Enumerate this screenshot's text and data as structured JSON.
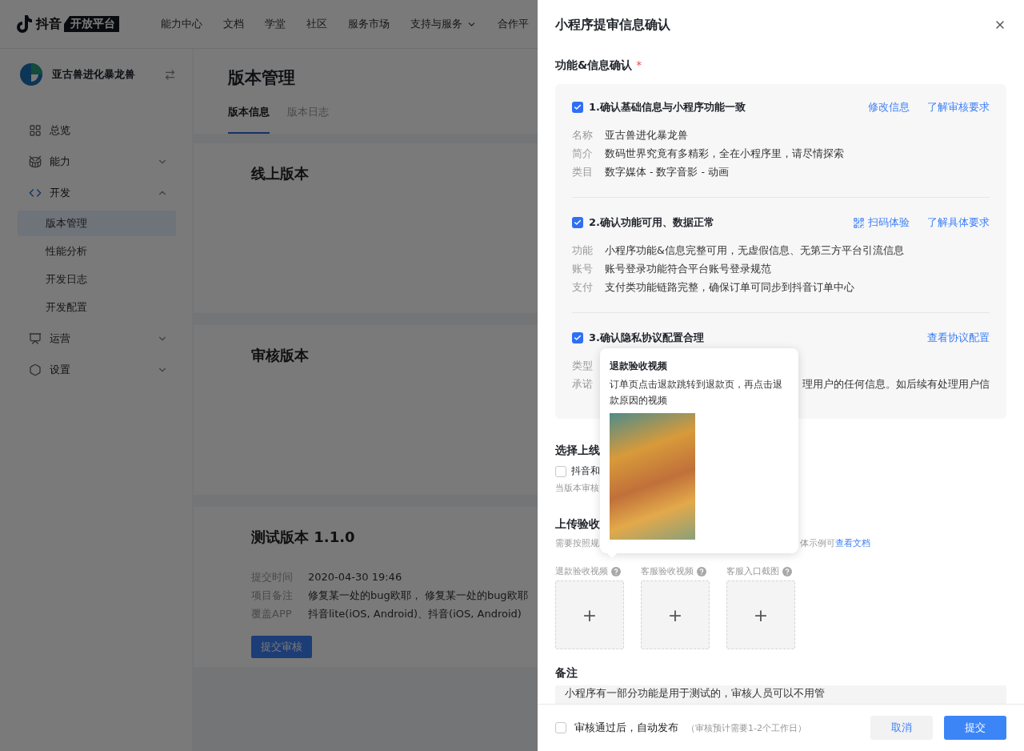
{
  "nav": {
    "logo": "抖音",
    "badge": "开放平台",
    "items": [
      {
        "label": "能力中心",
        "dropdown": false
      },
      {
        "label": "文档",
        "dropdown": false
      },
      {
        "label": "学堂",
        "dropdown": false
      },
      {
        "label": "社区",
        "dropdown": false
      },
      {
        "label": "服务市场",
        "dropdown": false
      },
      {
        "label": "支持与服务",
        "dropdown": true
      },
      {
        "label": "合作平",
        "dropdown": false
      }
    ]
  },
  "sidebar": {
    "app_name": "亚古兽进化暴龙兽",
    "items": [
      {
        "label": "总览"
      },
      {
        "label": "能力",
        "expanded": false
      },
      {
        "label": "开发",
        "expanded": true,
        "children": [
          {
            "label": "版本管理",
            "selected": true
          },
          {
            "label": "性能分析",
            "selected": false
          },
          {
            "label": "开发日志",
            "selected": false
          },
          {
            "label": "开发配置",
            "selected": false
          }
        ]
      },
      {
        "label": "运营",
        "expanded": false
      },
      {
        "label": "设置",
        "expanded": false
      }
    ]
  },
  "page": {
    "title": "版本管理",
    "tabs": [
      {
        "label": "版本信息",
        "selected": true
      },
      {
        "label": "版本日志",
        "selected": false
      }
    ],
    "cards": [
      {
        "title": "线上版本"
      },
      {
        "title": "审核版本"
      },
      {
        "title": "测试版本 1.1.0",
        "rows": [
          {
            "label": "提交时间",
            "value": "2020-04-30 19:46"
          },
          {
            "label": "项目备注",
            "value": "修复某一处的bug欧耶， 修复某一处的bug欧耶"
          },
          {
            "label": "覆盖APP",
            "value": "抖音lite(iOS, Android)、抖音(iOS, Android)"
          }
        ],
        "button": "提交审核"
      }
    ]
  },
  "drawer": {
    "title": "小程序提审信息确认",
    "confirm": {
      "title": "功能&信息确认",
      "required_mark": "*",
      "items": [
        {
          "title": "1.确认基础信息与小程序功能一致",
          "checked": true,
          "links": [
            {
              "label": "修改信息",
              "kind": "plain"
            },
            {
              "label": "了解审核要求",
              "kind": "plain"
            }
          ],
          "rows": [
            {
              "label": "名称",
              "value": "亚古兽进化暴龙兽"
            },
            {
              "label": "简介",
              "value": "数码世界究竟有多精彩，全在小程序里，请尽情探索"
            },
            {
              "label": "类目",
              "value": "数字媒体 - 数字音影 - 动画"
            }
          ]
        },
        {
          "title": "2.确认功能可用、数据正常",
          "checked": true,
          "links": [
            {
              "label": "扫码体验",
              "kind": "qr"
            },
            {
              "label": "了解具体要求",
              "kind": "plain"
            }
          ],
          "rows": [
            {
              "label": "功能",
              "value": "小程序功能&信息完整可用，无虚假信息、无第三方平台引流信息"
            },
            {
              "label": "账号",
              "value": "账号登录功能符合平台账号登录规范"
            },
            {
              "label": "支付",
              "value": "支付类功能链路完整，确保订单可同步到抖音订单中心"
            }
          ]
        },
        {
          "title": "3.确认隐私协议配置合理",
          "checked": true,
          "links": [
            {
              "label": "查看协议配置",
              "kind": "plain"
            }
          ],
          "rows": [
            {
              "label": "类型"
            },
            {
              "label": "承诺",
              "value": "理用户的任何信息。如后续有处理用户信",
              "covered": true
            }
          ]
        }
      ]
    },
    "launch": {
      "title": "选择上线",
      "option": {
        "label": "抖音和",
        "checked": false
      },
      "hint": "当版本审核"
    },
    "upload": {
      "title": "上传验收",
      "hint_before": "需要按照规",
      "hint_after": "体示例可",
      "hint_link": "查看文档",
      "slots": [
        {
          "label": "退款验收视频",
          "symbol": "+"
        },
        {
          "label": "客服验收视频",
          "symbol": "+"
        },
        {
          "label": "客服入口截图",
          "symbol": "+"
        }
      ]
    },
    "remark": {
      "title": "备注",
      "value": "小程序有一部分功能是用于测试的，审核人员可以不用管"
    },
    "popover": {
      "title": "退款验收视频",
      "text": "订单页点击退款跳转到退款页，再点击退款原因的视频"
    },
    "footer": {
      "auto_publish": {
        "label": "审核通过后，自动发布",
        "hint": "（审核预计需要1-2个工作日）",
        "checked": false
      },
      "buttons": [
        {
          "label": "取消",
          "kind": "secondary"
        },
        {
          "label": "提交",
          "kind": "primary"
        }
      ]
    }
  }
}
